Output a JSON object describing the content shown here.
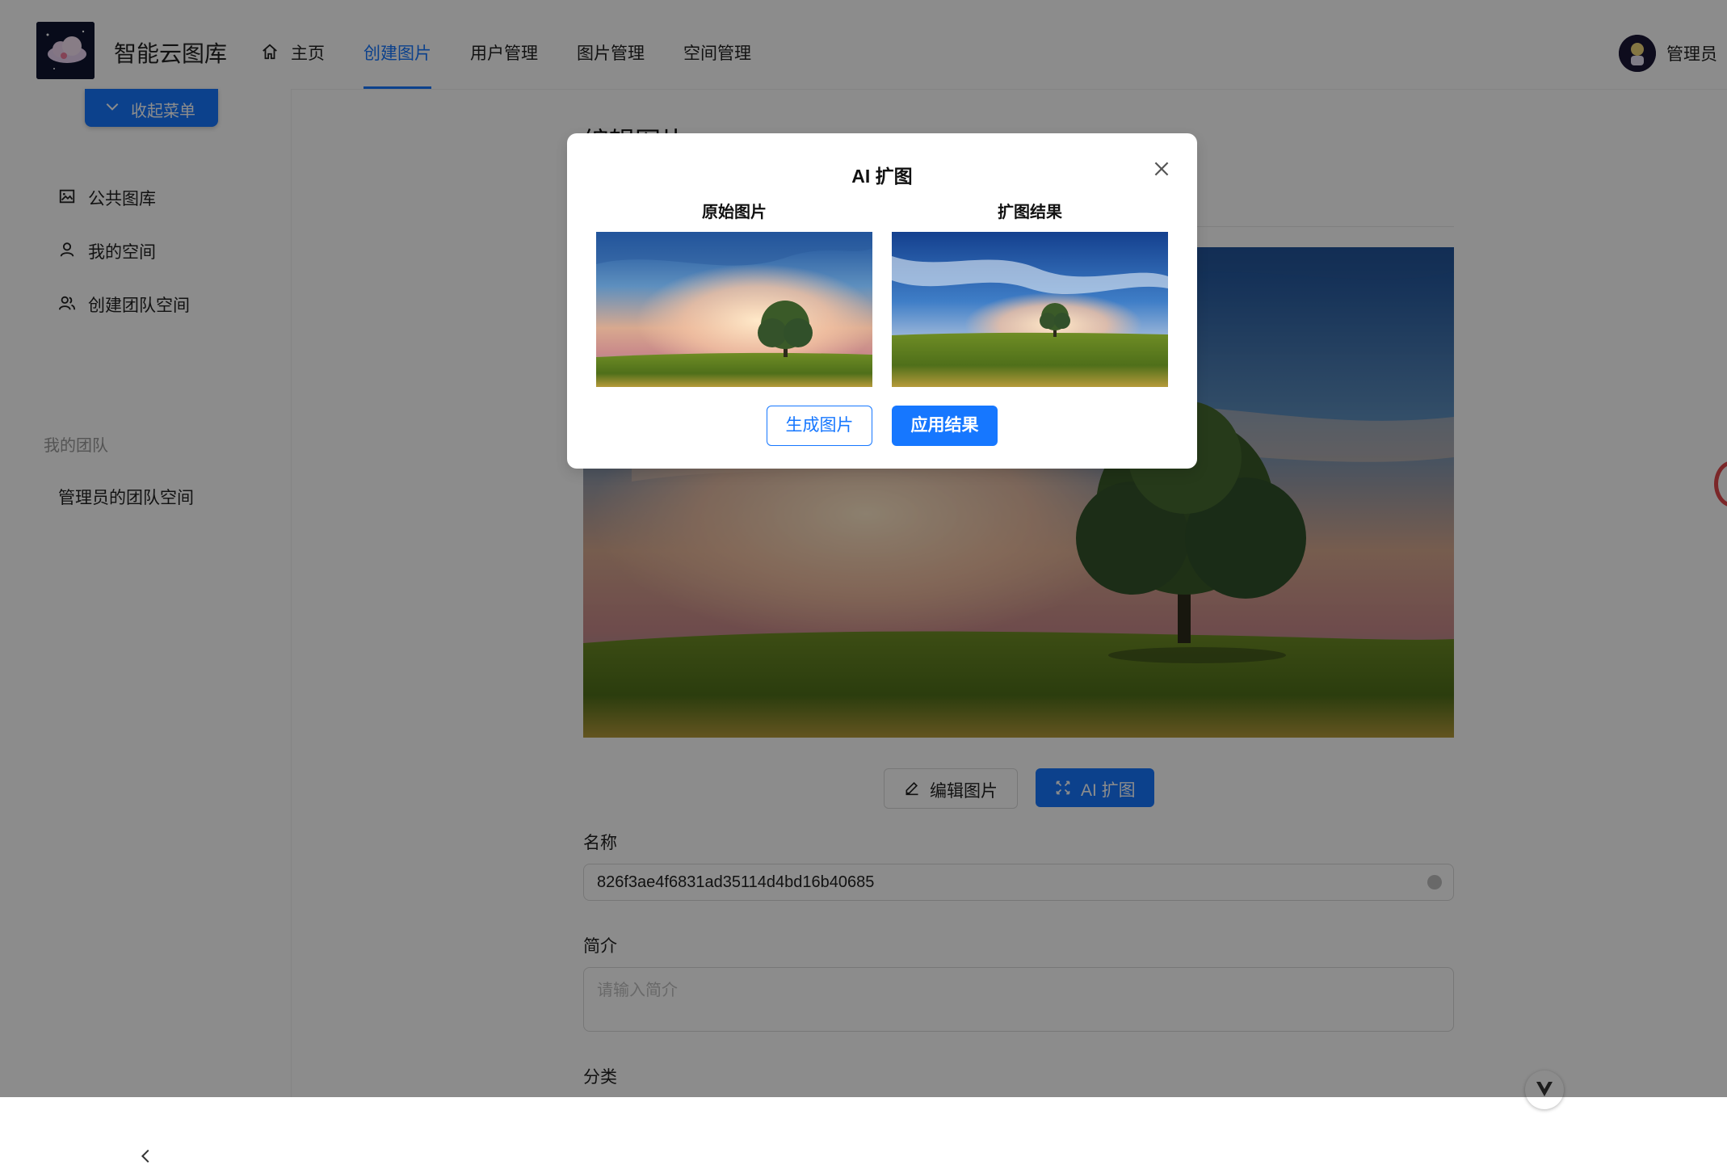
{
  "header": {
    "app_title": "智能云图库",
    "nav": [
      {
        "label": "主页",
        "icon": "home-icon"
      },
      {
        "label": "创建图片",
        "active": true
      },
      {
        "label": "用户管理"
      },
      {
        "label": "图片管理"
      },
      {
        "label": "空间管理"
      }
    ],
    "user_name": "管理员"
  },
  "sidebar": {
    "collapse_label": "收起菜单",
    "items": [
      {
        "label": "公共图库",
        "icon": "picture-icon"
      },
      {
        "label": "我的空间",
        "icon": "user-icon"
      },
      {
        "label": "创建团队空间",
        "icon": "team-icon"
      }
    ],
    "group_title": "我的团队",
    "team_items": [
      {
        "label": "管理员的团队空间"
      }
    ]
  },
  "main": {
    "page_title": "编辑图片",
    "actions": {
      "edit_label": "编辑图片",
      "ai_label": "AI 扩图"
    },
    "form": {
      "name_label": "名称",
      "name_value": "826f3ae4f6831ad35114d4bd16b40685",
      "intro_label": "简介",
      "intro_placeholder": "请输入简介",
      "category_label": "分类"
    }
  },
  "modal": {
    "title": "AI 扩图",
    "original_label": "原始图片",
    "result_label": "扩图结果",
    "generate_label": "生成图片",
    "apply_label": "应用结果"
  },
  "colors": {
    "primary": "#1677ff",
    "mask": "rgba(0,0,0,0.45)"
  }
}
